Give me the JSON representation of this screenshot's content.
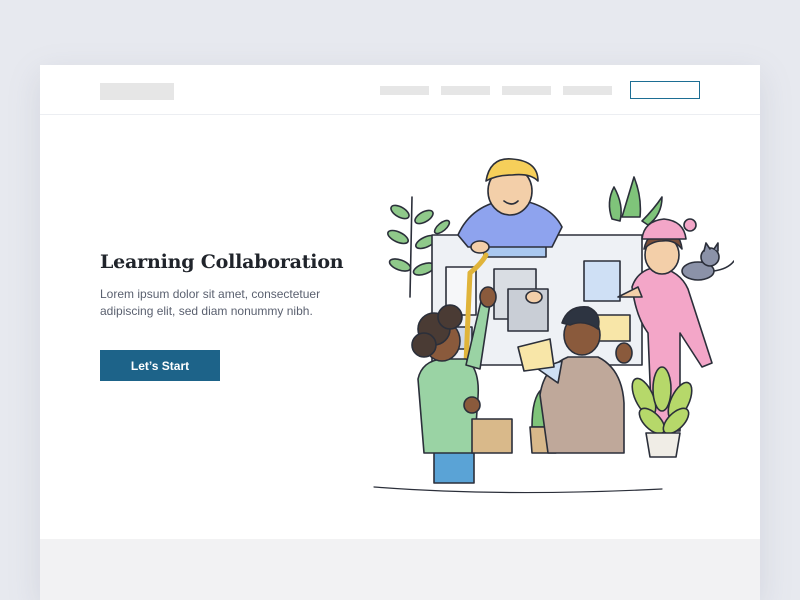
{
  "colors": {
    "background": "#e7e9ef",
    "accent": "#1d6389",
    "title": "#20242b",
    "body_text": "#5b6170",
    "placeholder": "#e6e6e6",
    "footer": "#f2f2f3"
  },
  "hero": {
    "title": "Learning Collaboration",
    "description": "Lorem ipsum dolor sit amet, consectetuer adipiscing elit, sed diam nonummy nibh.",
    "cta_label": "Let’s Start"
  }
}
